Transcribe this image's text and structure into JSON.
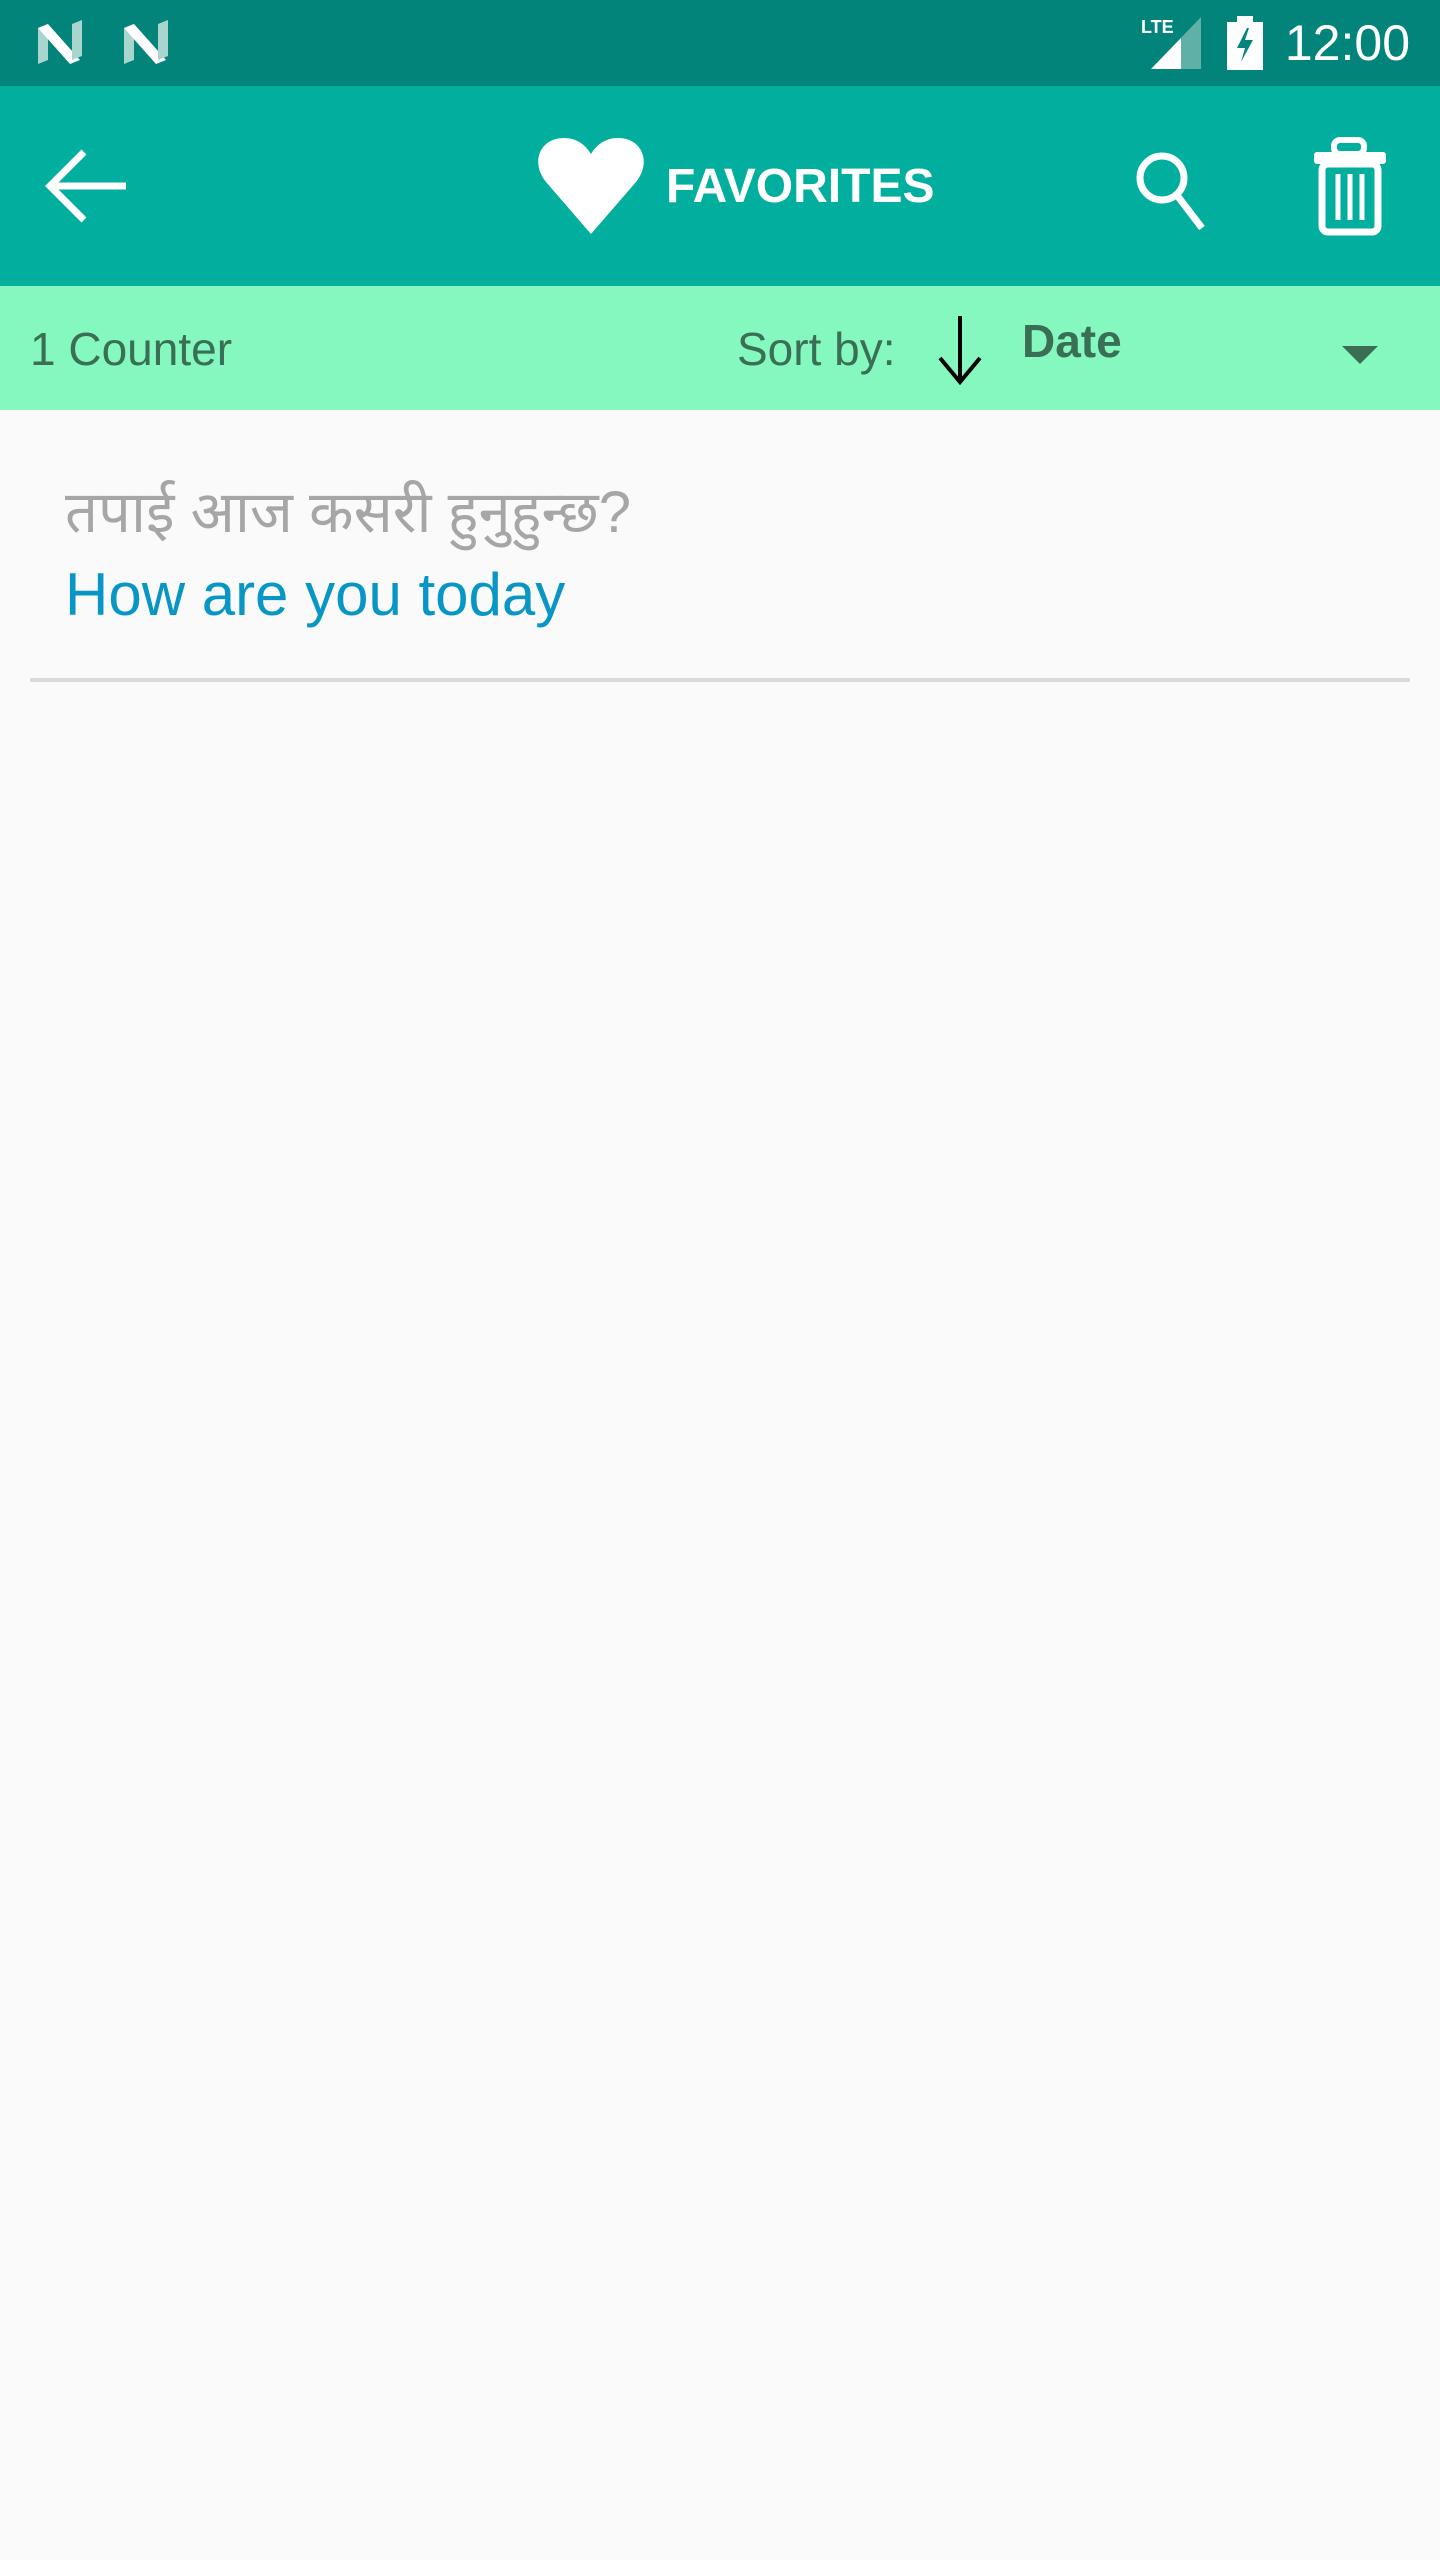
{
  "status_bar": {
    "time": "12:00",
    "network": "LTE",
    "icons": [
      "notification-n-icon",
      "notification-n-icon",
      "lte-signal-icon",
      "battery-charging-icon"
    ]
  },
  "app_bar": {
    "title": "FAVORITES",
    "icons": {
      "back": "back-arrow-icon",
      "title": "heart-icon",
      "search": "search-icon",
      "delete": "trash-icon"
    }
  },
  "sort_bar": {
    "counter": "1 Counter",
    "sort_label": "Sort by:",
    "sort_value": "Date",
    "sort_direction": "descending"
  },
  "favorites": [
    {
      "source": "तपाई आज कसरी हुनुहुन्छ?",
      "translation": "How are you today"
    }
  ],
  "colors": {
    "status_bar": "#03847a",
    "app_bar": "#02ae9d",
    "sort_bar": "#84f8bf",
    "translation_text": "#0796c6",
    "source_text": "#a6a6a6"
  }
}
